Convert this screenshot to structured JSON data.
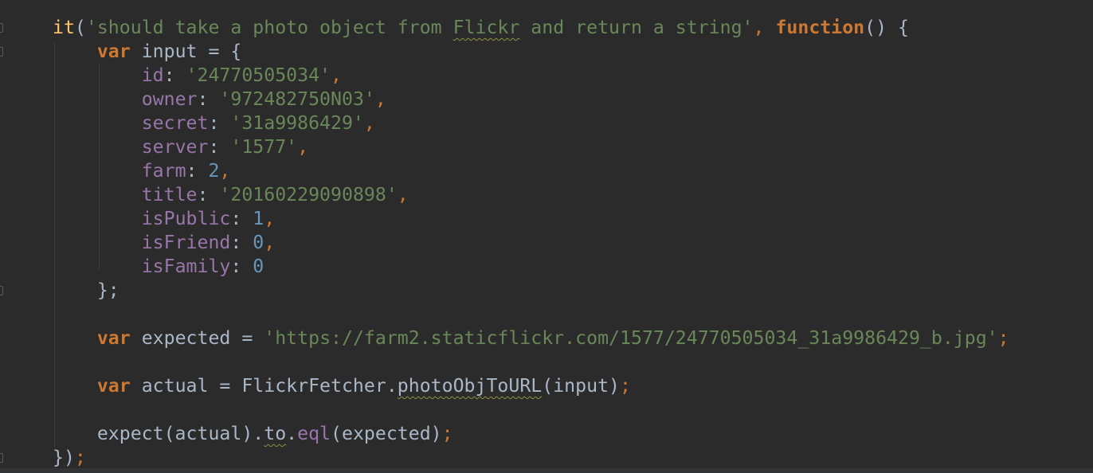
{
  "colors": {
    "background": "#2b2b2b",
    "keyword": "#cc7832",
    "string": "#6a8759",
    "number": "#6897bb",
    "property": "#9876aa",
    "function": "#ffc66d",
    "plain": "#a9b7c6"
  },
  "code_lines": [
    [
      [
        "fn",
        "it"
      ],
      [
        "pl",
        "("
      ],
      [
        "str",
        "'should take a photo object from "
      ],
      [
        "str typo",
        "Flickr"
      ],
      [
        "str",
        " and return a string'"
      ],
      [
        "punc",
        ", "
      ],
      [
        "kw",
        "function"
      ],
      [
        "pl",
        "() {"
      ]
    ],
    [
      [
        "pl",
        "    "
      ],
      [
        "kw",
        "var"
      ],
      [
        "pl",
        " input = {"
      ]
    ],
    [
      [
        "pl",
        "        "
      ],
      [
        "prop",
        "id"
      ],
      [
        "pl",
        ": "
      ],
      [
        "str",
        "'24770505034'"
      ],
      [
        "punc",
        ","
      ]
    ],
    [
      [
        "pl",
        "        "
      ],
      [
        "prop",
        "owner"
      ],
      [
        "pl",
        ": "
      ],
      [
        "str",
        "'972482750N03'"
      ],
      [
        "punc",
        ","
      ]
    ],
    [
      [
        "pl",
        "        "
      ],
      [
        "prop",
        "secret"
      ],
      [
        "pl",
        ": "
      ],
      [
        "str",
        "'31a9986429'"
      ],
      [
        "punc",
        ","
      ]
    ],
    [
      [
        "pl",
        "        "
      ],
      [
        "prop",
        "server"
      ],
      [
        "pl",
        ": "
      ],
      [
        "str",
        "'1577'"
      ],
      [
        "punc",
        ","
      ]
    ],
    [
      [
        "pl",
        "        "
      ],
      [
        "prop",
        "farm"
      ],
      [
        "pl",
        ": "
      ],
      [
        "num",
        "2"
      ],
      [
        "punc",
        ","
      ]
    ],
    [
      [
        "pl",
        "        "
      ],
      [
        "prop",
        "title"
      ],
      [
        "pl",
        ": "
      ],
      [
        "str",
        "'20160229090898'"
      ],
      [
        "punc",
        ","
      ]
    ],
    [
      [
        "pl",
        "        "
      ],
      [
        "prop",
        "isPublic"
      ],
      [
        "pl",
        ": "
      ],
      [
        "num",
        "1"
      ],
      [
        "punc",
        ","
      ]
    ],
    [
      [
        "pl",
        "        "
      ],
      [
        "prop",
        "isFriend"
      ],
      [
        "pl",
        ": "
      ],
      [
        "num",
        "0"
      ],
      [
        "punc",
        ","
      ]
    ],
    [
      [
        "pl",
        "        "
      ],
      [
        "prop",
        "isFamily"
      ],
      [
        "pl",
        ": "
      ],
      [
        "num",
        "0"
      ]
    ],
    [
      [
        "pl",
        "    };"
      ]
    ],
    [
      [
        "pl",
        ""
      ]
    ],
    [
      [
        "pl",
        "    "
      ],
      [
        "kw",
        "var"
      ],
      [
        "pl",
        " expected = "
      ],
      [
        "str",
        "'https://farm2.staticflickr.com/1577/24770505034_31a9986429_b.jpg'"
      ],
      [
        "punc",
        ";"
      ]
    ],
    [
      [
        "pl",
        ""
      ]
    ],
    [
      [
        "pl",
        "    "
      ],
      [
        "kw",
        "var"
      ],
      [
        "pl",
        " actual = FlickrFetcher."
      ],
      [
        "pl typo",
        "photoObjToURL"
      ],
      [
        "pl",
        "(input)"
      ],
      [
        "punc",
        ";"
      ]
    ],
    [
      [
        "pl",
        ""
      ]
    ],
    [
      [
        "pl",
        "    expect(actual)."
      ],
      [
        "pl typo",
        "to"
      ],
      [
        "pl",
        "."
      ],
      [
        "prop",
        "eql"
      ],
      [
        "pl",
        "(expected)"
      ],
      [
        "punc",
        ";"
      ]
    ],
    [
      [
        "pl",
        "})"
      ],
      [
        "punc",
        ";"
      ]
    ]
  ]
}
